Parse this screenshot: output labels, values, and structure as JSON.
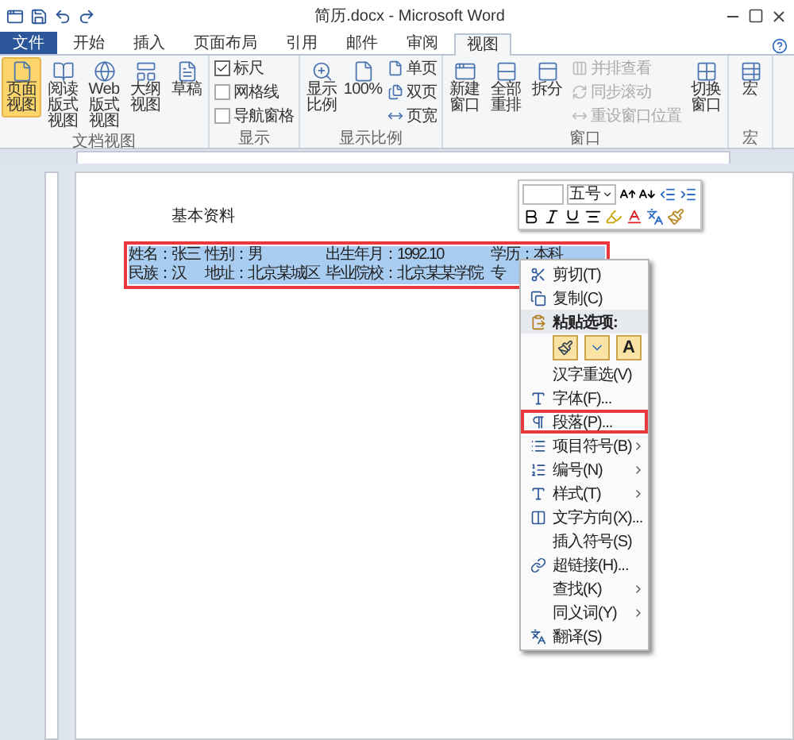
{
  "window": {
    "title": "简历.docx - Microsoft Word"
  },
  "tabs": [
    {
      "label": "文件",
      "selected": false,
      "kind": "file"
    },
    {
      "label": "开始",
      "selected": false,
      "kind": "tab"
    },
    {
      "label": "插入",
      "selected": false,
      "kind": "tab"
    },
    {
      "label": "页面布局",
      "selected": false,
      "kind": "tab"
    },
    {
      "label": "引用",
      "selected": false,
      "kind": "tab"
    },
    {
      "label": "邮件",
      "selected": false,
      "kind": "tab"
    },
    {
      "label": "审阅",
      "selected": false,
      "kind": "tab"
    },
    {
      "label": "视图",
      "selected": true,
      "kind": "tab"
    }
  ],
  "ribbon": [
    {
      "label": "文档视图",
      "items": [
        {
          "kind": "large",
          "label": "页面视图",
          "selected": true
        },
        {
          "kind": "large",
          "label": "阅读版式视图",
          "selected": false
        },
        {
          "kind": "large",
          "label": "Web 版式视图",
          "selected": false
        },
        {
          "kind": "large",
          "label": "大纲视图",
          "selected": false
        },
        {
          "kind": "large",
          "label": "草稿",
          "selected": false
        }
      ]
    },
    {
      "label": "显示",
      "items": [
        {
          "kind": "check",
          "label": "标尺",
          "checked": true
        },
        {
          "kind": "check",
          "label": "网格线",
          "checked": false
        },
        {
          "kind": "check",
          "label": "导航窗格",
          "checked": false
        }
      ]
    },
    {
      "label": "显示比例",
      "items": [
        {
          "kind": "large",
          "label": "显示比例",
          "selected": false
        },
        {
          "kind": "large",
          "label": "100%",
          "selected": false
        },
        {
          "kind": "small",
          "label": "单页",
          "disabled": false
        },
        {
          "kind": "small",
          "label": "双页",
          "disabled": false
        },
        {
          "kind": "small",
          "label": "页宽",
          "disabled": false
        }
      ]
    },
    {
      "label": "窗口",
      "items": [
        {
          "kind": "large",
          "label": "新建窗口",
          "selected": false
        },
        {
          "kind": "large",
          "label": "全部重排",
          "selected": false
        },
        {
          "kind": "large",
          "label": "拆分",
          "selected": false
        },
        {
          "kind": "small",
          "label": "并排查看",
          "disabled": true
        },
        {
          "kind": "small",
          "label": "同步滚动",
          "disabled": true
        },
        {
          "kind": "small",
          "label": "重设窗口位置",
          "disabled": true
        },
        {
          "kind": "large",
          "label": "切换窗口",
          "selected": false
        }
      ]
    },
    {
      "label": "宏",
      "items": [
        {
          "kind": "large",
          "label": "宏",
          "selected": false
        }
      ]
    }
  ],
  "document": {
    "heading": "基本资料",
    "rows": [
      [
        "姓名：张三",
        "性别：男",
        "出生年月：1992.10",
        "学历：本科"
      ],
      [
        "民族：汉",
        "地址：北京某城区",
        "毕业院校：北京某某学院",
        "专"
      ]
    ]
  },
  "mini_toolbar": {
    "font_size": "五号"
  },
  "context_menu": [
    {
      "kind": "item",
      "label": "剪切(T)",
      "submenu": false,
      "highlighted": false
    },
    {
      "kind": "item",
      "label": "复制(C)",
      "submenu": false,
      "highlighted": false
    },
    {
      "kind": "header",
      "label": "粘贴选项:"
    },
    {
      "kind": "paste",
      "letter": "A"
    },
    {
      "kind": "item",
      "label": "汉字重选(V)",
      "submenu": false,
      "highlighted": false
    },
    {
      "kind": "item",
      "label": "字体(F)...",
      "submenu": false,
      "highlighted": false
    },
    {
      "kind": "item",
      "label": "段落(P)...",
      "submenu": false,
      "highlighted": true
    },
    {
      "kind": "item",
      "label": "项目符号(B)",
      "submenu": true,
      "highlighted": false
    },
    {
      "kind": "item",
      "label": "编号(N)",
      "submenu": true,
      "highlighted": false
    },
    {
      "kind": "item",
      "label": "样式(T)",
      "submenu": true,
      "highlighted": false
    },
    {
      "kind": "item",
      "label": "文字方向(X)...",
      "submenu": false,
      "highlighted": false
    },
    {
      "kind": "item",
      "label": "插入符号(S)",
      "submenu": false,
      "highlighted": false
    },
    {
      "kind": "item",
      "label": "超链接(H)...",
      "submenu": false,
      "highlighted": false
    },
    {
      "kind": "item",
      "label": "查找(K)",
      "submenu": true,
      "highlighted": false
    },
    {
      "kind": "item",
      "label": "同义词(Y)",
      "submenu": true,
      "highlighted": false
    },
    {
      "kind": "item",
      "label": "翻译(S)",
      "submenu": false,
      "highlighted": false
    }
  ]
}
